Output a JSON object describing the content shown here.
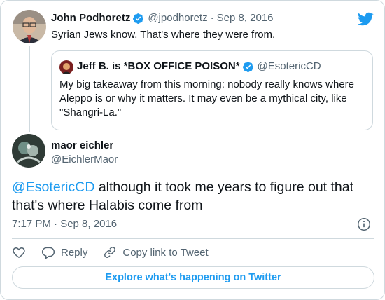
{
  "parent_tweet": {
    "author_name": "John Podhoretz",
    "author_handle": "@jpodhoretz",
    "separator": "·",
    "date": "Sep 8, 2016",
    "text": "Syrian Jews know. That's where they were from."
  },
  "quoted_tweet": {
    "author_name": "Jeff B. is *BOX OFFICE POISON*",
    "author_handle": "@EsotericCD",
    "text": "My big takeaway from this morning: nobody really knows where Aleppo is or why it matters. It may even be a mythical city, like \"Shangri-La.\""
  },
  "main_tweet": {
    "author_name": "maor eichler",
    "author_handle": "@EichlerMaor",
    "mention": "@EsotericCD",
    "text": " although it took me years to figure out that that's where Halabis come from",
    "timestamp": "7:17 PM · Sep 8, 2016"
  },
  "actions": {
    "like_icon": "heart-icon",
    "reply_label": "Reply",
    "copy_link_label": "Copy link to Tweet"
  },
  "explore_button": "Explore what's happening on Twitter",
  "colors": {
    "accent": "#1d9bf0",
    "text": "#0f1419",
    "secondary": "#536471",
    "border": "#cfd9de"
  }
}
